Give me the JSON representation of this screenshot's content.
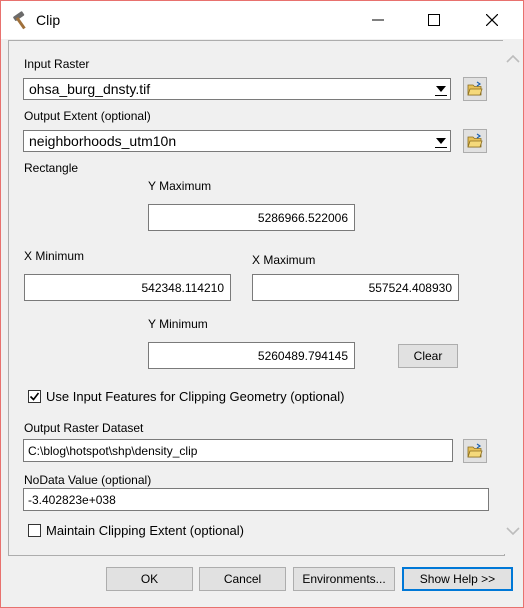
{
  "window": {
    "title": "Clip"
  },
  "form": {
    "input_raster_label": "Input Raster",
    "input_raster_value": "ohsa_burg_dnsty.tif",
    "output_extent_label": "Output Extent (optional)",
    "output_extent_value": "neighborhoods_utm10n",
    "rectangle_label": "Rectangle",
    "y_max_label": "Y Maximum",
    "y_max_value": "5286966.522006",
    "x_min_label": "X Minimum",
    "x_min_value": "542348.114210",
    "x_max_label": "X Maximum",
    "x_max_value": "557524.408930",
    "y_min_label": "Y Minimum",
    "y_min_value": "5260489.794145",
    "clear_label": "Clear",
    "use_input_features_label": "Use Input Features for Clipping Geometry (optional)",
    "use_input_features_checked": true,
    "output_raster_label": "Output Raster Dataset",
    "output_raster_value": "C:\\blog\\hotspot\\shp\\density_clip",
    "nodata_label": "NoData Value (optional)",
    "nodata_value": "-3.402823e+038",
    "maintain_extent_label": "Maintain Clipping Extent (optional)",
    "maintain_extent_checked": false
  },
  "footer": {
    "ok_label": "OK",
    "cancel_label": "Cancel",
    "environments_label": "Environments...",
    "show_help_label": "Show Help >>"
  },
  "icons": {
    "app": "hammer-icon",
    "minimize": "minimize-icon",
    "maximize": "maximize-icon",
    "close": "close-icon",
    "browse": "open-folder-icon",
    "dropdown": "chevron-down-icon",
    "scroll_up": "scroll-up-icon",
    "scroll_down": "scroll-down-icon"
  },
  "colors": {
    "window_border": "#e8716e",
    "accent": "#0078d7"
  }
}
